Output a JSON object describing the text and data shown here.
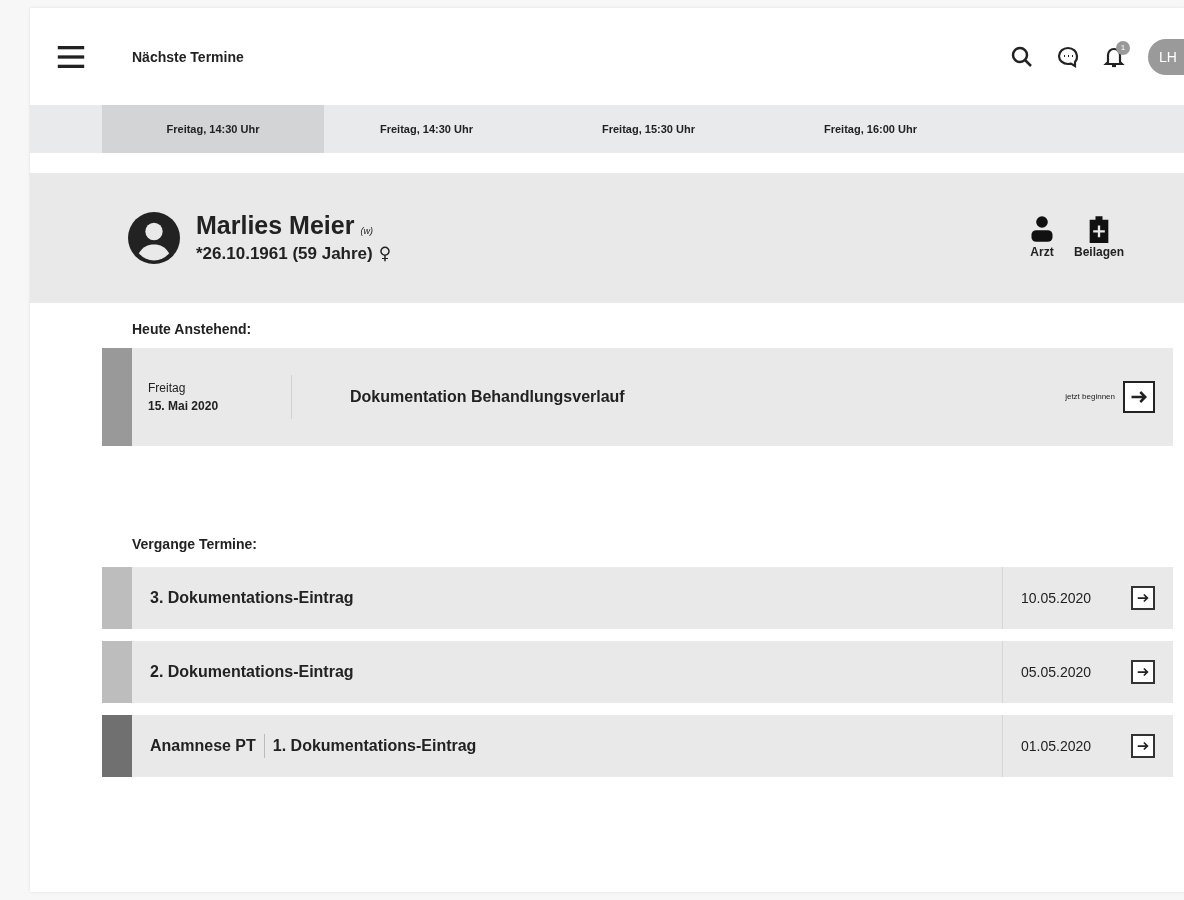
{
  "header": {
    "title": "Nächste Termine",
    "notification_count": "1",
    "avatar": "LH"
  },
  "tabs": [
    {
      "label": "Freitag, 14:30 Uhr",
      "selected": true
    },
    {
      "label": "Freitag, 14:30 Uhr",
      "selected": false
    },
    {
      "label": "Freitag, 15:30 Uhr",
      "selected": false
    },
    {
      "label": "Freitag, 16:00 Uhr",
      "selected": false
    }
  ],
  "patient": {
    "name": "Marlies Meier",
    "pronoun": "(w)",
    "birth": "*26.10.1961 (59 Jahre)",
    "sex_symbol": "♀",
    "actions": [
      {
        "kind": "doctor",
        "label": "Arzt"
      },
      {
        "kind": "attachments",
        "label": "Beilagen"
      }
    ]
  },
  "today": {
    "heading": "Heute Anstehend:",
    "day": "Freitag",
    "date": "15. Mai 2020",
    "title": "Dokumentation Behandlungsverlauf",
    "action": "jetzt beginnen",
    "color": "#999999"
  },
  "past": {
    "heading": "Vergange Termine:",
    "rows": [
      {
        "parts": [
          "3. Dokumentations-Eintrag"
        ],
        "date": "10.05.2020",
        "color": "#bdbdbd"
      },
      {
        "parts": [
          "2. Dokumentations-Eintrag"
        ],
        "date": "05.05.2020",
        "color": "#bdbdbd"
      },
      {
        "parts": [
          "Anamnese PT",
          "1. Dokumentations-Eintrag"
        ],
        "date": "01.05.2020",
        "color": "#707070"
      }
    ]
  }
}
